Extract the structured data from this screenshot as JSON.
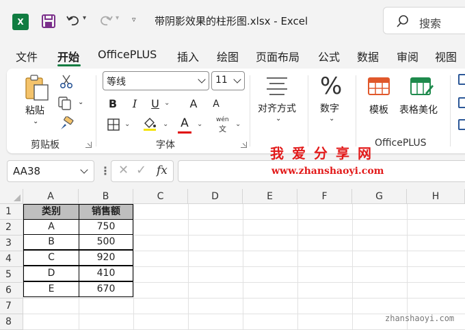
{
  "titlebar": {
    "app_logo": "X",
    "doc_title": "带阴影效果的柱形图.xlsx  -  Excel",
    "search_placeholder": "搜索"
  },
  "tabs": [
    {
      "label": "文件",
      "active": false
    },
    {
      "label": "开始",
      "active": true
    },
    {
      "label": "OfficePLUS",
      "active": false
    },
    {
      "label": "插入",
      "active": false
    },
    {
      "label": "绘图",
      "active": false
    },
    {
      "label": "页面布局",
      "active": false
    },
    {
      "label": "公式",
      "active": false
    },
    {
      "label": "数据",
      "active": false
    },
    {
      "label": "审阅",
      "active": false
    },
    {
      "label": "视图",
      "active": false
    }
  ],
  "ribbon": {
    "clipboard": {
      "paste_label": "粘贴",
      "group_label": "剪贴板"
    },
    "font": {
      "font_name": "等线",
      "font_size": "11",
      "bold": "B",
      "italic": "I",
      "underline": "U",
      "grow": "A",
      "shrink": "A",
      "font_color_letter": "A",
      "wen_label": "wén",
      "wen_char": "文",
      "group_label": "字体"
    },
    "alignment": {
      "label": "对齐方式"
    },
    "number": {
      "icon": "%",
      "label": "数字"
    },
    "officeplus": {
      "template_label": "模板",
      "beautify_label": "表格美化",
      "group_label": "OfficePLUS"
    }
  },
  "formula_bar": {
    "namebox": "AA38",
    "cancel": "✕",
    "enter": "✓",
    "fx": "fx",
    "value": ""
  },
  "watermark": {
    "title": "我爱分享网",
    "url": "www.zhanshaoyi.com",
    "bottom": "zhanshaoyi.com"
  },
  "sheet": {
    "columns": [
      "A",
      "B",
      "C",
      "D",
      "E",
      "F",
      "G",
      "H"
    ],
    "rows": [
      "1",
      "2",
      "3",
      "4",
      "5",
      "6",
      "7",
      "8"
    ],
    "table_header": [
      "类别",
      "销售额"
    ],
    "table_rows": [
      [
        "A",
        "750"
      ],
      [
        "B",
        "500"
      ],
      [
        "C",
        "920"
      ],
      [
        "D",
        "410"
      ],
      [
        "E",
        "670"
      ]
    ]
  },
  "colors": {
    "accent": "#107c41",
    "watermark": "#e21a1a",
    "header_fill": "#bfbfbf"
  }
}
